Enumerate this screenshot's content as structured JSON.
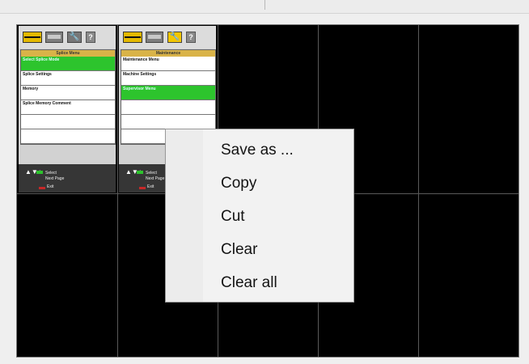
{
  "panels": [
    {
      "title": "Splice Menu",
      "items": [
        {
          "label": "Select Splice Mode",
          "selected": true
        },
        {
          "label": "Splice Settings",
          "selected": false
        },
        {
          "label": "Memory",
          "selected": false
        },
        {
          "label": "Splice Memory Comment",
          "selected": false
        },
        {
          "label": "",
          "selected": false
        },
        {
          "label": "",
          "selected": false
        }
      ],
      "help": {
        "select": "Select",
        "next_page": "Next Page",
        "exit": "Exit"
      }
    },
    {
      "title": "Maintenance",
      "items": [
        {
          "label": "Maintenance Menu",
          "selected": false
        },
        {
          "label": "Machine Settings",
          "selected": false
        },
        {
          "label": "Supervisor Menu",
          "selected": true
        }
      ],
      "help": {
        "select": "Select",
        "next_page": "Next Page",
        "exit": "Exit"
      }
    }
  ],
  "toolbar_icons": [
    "splice-mode-icon",
    "machine-icon",
    "wrench-icon",
    "help-icon"
  ],
  "toolbar_glyphs": {
    "wrench": "🔧",
    "help": "?"
  },
  "help_arrows": "▲▼+",
  "context_menu": {
    "items": [
      "Save as ...",
      "Copy",
      "Cut",
      "Clear",
      "Clear all"
    ]
  },
  "colors": {
    "selected_green": "#2dc42d",
    "menu_title_gold": "#d9b348",
    "accent_yellow": "#f2c600",
    "grid_background": "#000000"
  }
}
